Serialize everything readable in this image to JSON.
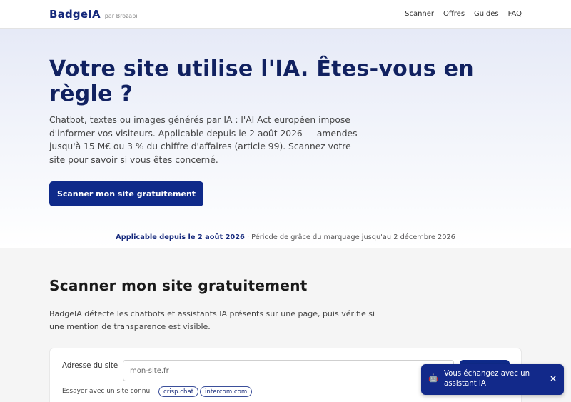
{
  "header": {
    "brand": "BadgeIA",
    "brand_sub": "par Brozapi",
    "nav": [
      "Scanner",
      "Offres",
      "Guides",
      "FAQ"
    ]
  },
  "hero": {
    "title": "Votre site utilise l'IA. Êtes-vous en règle ?",
    "description": "Chatbot, textes ou images générés par IA : l'AI Act européen impose d'informer vos visiteurs. Applicable depuis le 2 août 2026 — amendes jusqu'à 15 M€ ou 3 % du chiffre d'affaires (article 99). Scannez votre site pour savoir si vous êtes concerné.",
    "cta_label": "Scanner mon site gratuitement",
    "notice_strong": "Applicable depuis le 2 août 2026",
    "notice_rest": " · Période de grâce du marquage jusqu'au 2 décembre 2026"
  },
  "scanner": {
    "title": "Scanner mon site gratuitement",
    "description": "BadgeIA détecte les chatbots et assistants IA présents sur une page, puis vérifie si une mention de transparence est visible.",
    "field_label": "Adresse du site",
    "field_placeholder": "mon-site.fr",
    "field_value": "",
    "try_label": "Essayer avec un site connu :",
    "chips": [
      "crisp.chat",
      "intercom.com"
    ]
  },
  "toast": {
    "icon": "robot-icon",
    "text": "Vous échangez avec un assistant IA",
    "close": "×"
  },
  "colors": {
    "brand": "#15297c",
    "primary_button": "#0f2a8a",
    "toast_bg": "#12298a"
  }
}
